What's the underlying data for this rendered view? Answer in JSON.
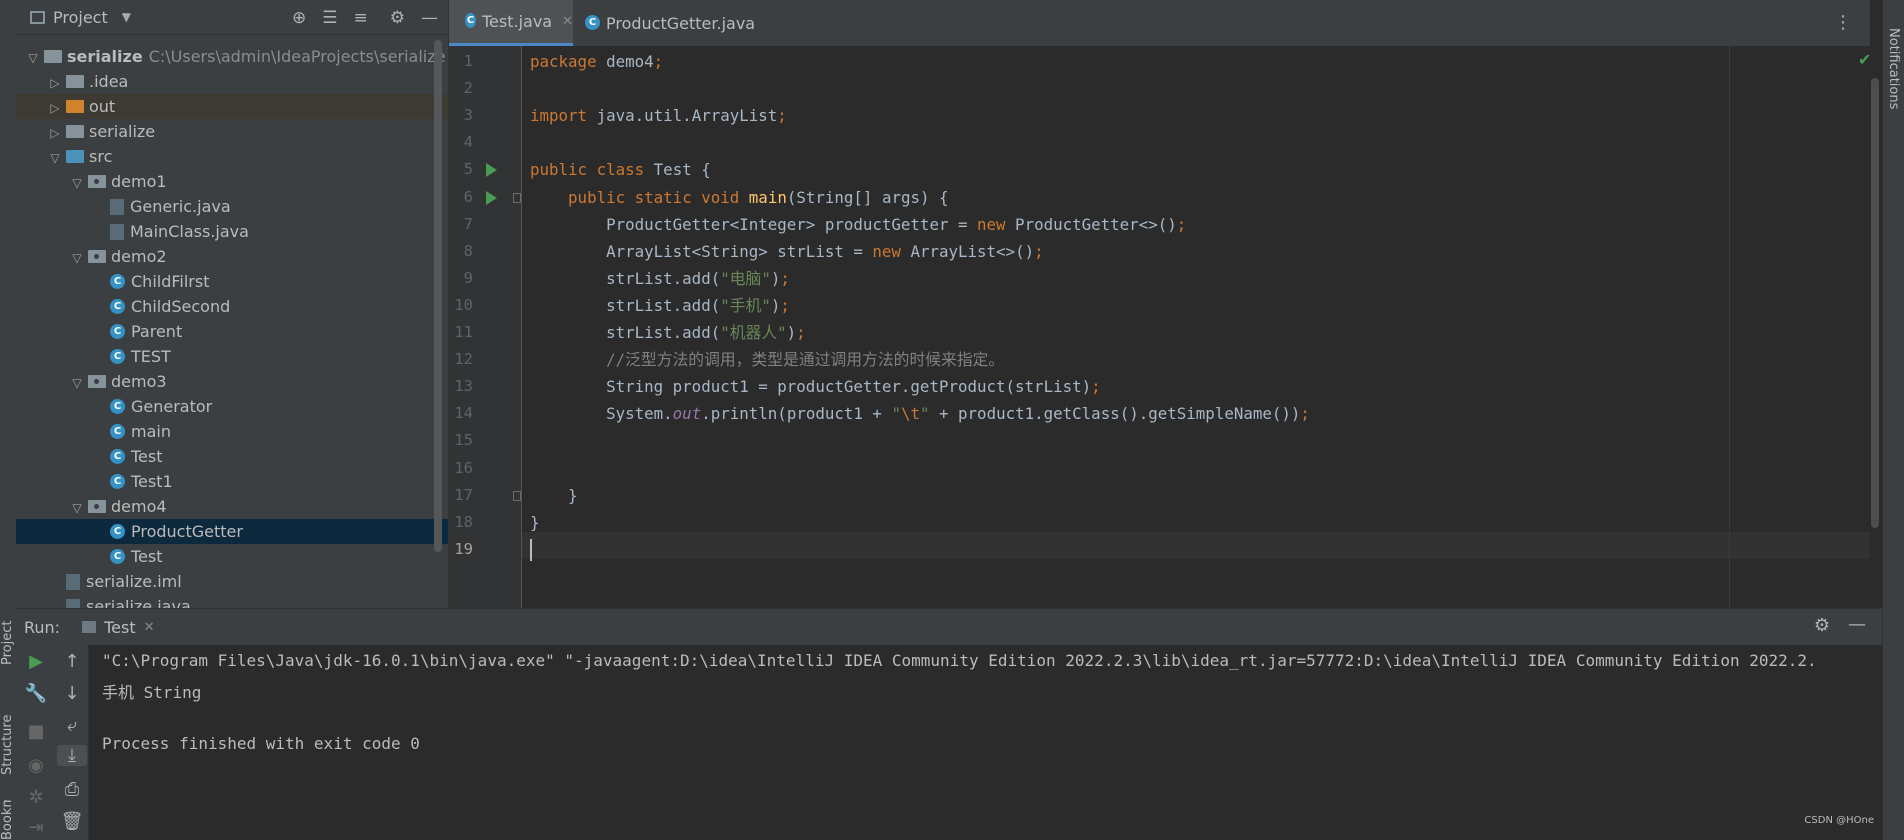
{
  "project": {
    "title": "Project",
    "tree": [
      {
        "label": "serialize",
        "path": "C:\\Users\\admin\\IdeaProjects\\serialize",
        "level": 0,
        "kind": "module",
        "expanded": true
      },
      {
        "label": ".idea",
        "level": 1,
        "kind": "folder",
        "expanded": false
      },
      {
        "label": "out",
        "level": 1,
        "kind": "folder-orange",
        "expanded": false
      },
      {
        "label": "serialize",
        "level": 1,
        "kind": "folder",
        "expanded": false
      },
      {
        "label": "src",
        "level": 1,
        "kind": "folder-blue",
        "expanded": true
      },
      {
        "label": "demo1",
        "level": 2,
        "kind": "package",
        "expanded": true
      },
      {
        "label": "Generic.java",
        "level": 3,
        "kind": "java-file"
      },
      {
        "label": "MainClass.java",
        "level": 3,
        "kind": "java-file"
      },
      {
        "label": "demo2",
        "level": 2,
        "kind": "package",
        "expanded": true
      },
      {
        "label": "ChildFilrst",
        "level": 3,
        "kind": "class"
      },
      {
        "label": "ChildSecond",
        "level": 3,
        "kind": "class"
      },
      {
        "label": "Parent",
        "level": 3,
        "kind": "class"
      },
      {
        "label": "TEST",
        "level": 3,
        "kind": "class"
      },
      {
        "label": "demo3",
        "level": 2,
        "kind": "package",
        "expanded": true
      },
      {
        "label": "Generator",
        "level": 3,
        "kind": "class"
      },
      {
        "label": "main",
        "level": 3,
        "kind": "class"
      },
      {
        "label": "Test",
        "level": 3,
        "kind": "class"
      },
      {
        "label": "Test1",
        "level": 3,
        "kind": "class"
      },
      {
        "label": "demo4",
        "level": 2,
        "kind": "package",
        "expanded": true
      },
      {
        "label": "ProductGetter",
        "level": 3,
        "kind": "class",
        "selected": true
      },
      {
        "label": "Test",
        "level": 3,
        "kind": "class"
      },
      {
        "label": "serialize.iml",
        "level": 1,
        "kind": "file"
      },
      {
        "label": "serialize.java",
        "level": 1,
        "kind": "file"
      }
    ]
  },
  "tabs": [
    {
      "label": "Test.java",
      "active": true
    },
    {
      "label": "ProductGetter.java",
      "active": false
    }
  ],
  "side_tabs": {
    "project": "Project",
    "structure": "Structure",
    "bookmarks": "Bookmarks",
    "notifications": "Notifications"
  },
  "code_lines": [
    "package demo4;",
    "",
    "import java.util.ArrayList;",
    "",
    "public class Test {",
    "    public static void main(String[] args) {",
    "        ProductGetter<Integer> productGetter = new ProductGetter<>();",
    "        ArrayList<String> strList = new ArrayList<>();",
    "        strList.add(\"电脑\");",
    "        strList.add(\"手机\");",
    "        strList.add(\"机器人\");",
    "        //泛型方法的调用，类型是通过调用方法的时候来指定。",
    "        String product1 = productGetter.getProduct(strList);",
    "        System.out.println(product1 + \"\\t\" + product1.getClass().getSimpleName());",
    "",
    "",
    "    }",
    "}",
    ""
  ],
  "run": {
    "label": "Run:",
    "tab": "Test",
    "output": [
      "\"C:\\Program Files\\Java\\jdk-16.0.1\\bin\\java.exe\" \"-javaagent:D:\\idea\\IntelliJ IDEA Community Edition 2022.2.3\\lib\\idea_rt.jar=57772:D:\\idea\\IntelliJ IDEA Community Edition 2022.2.",
      "手机 String",
      "",
      "Process finished with exit code 0"
    ]
  },
  "watermark": "CSDN @HOne"
}
